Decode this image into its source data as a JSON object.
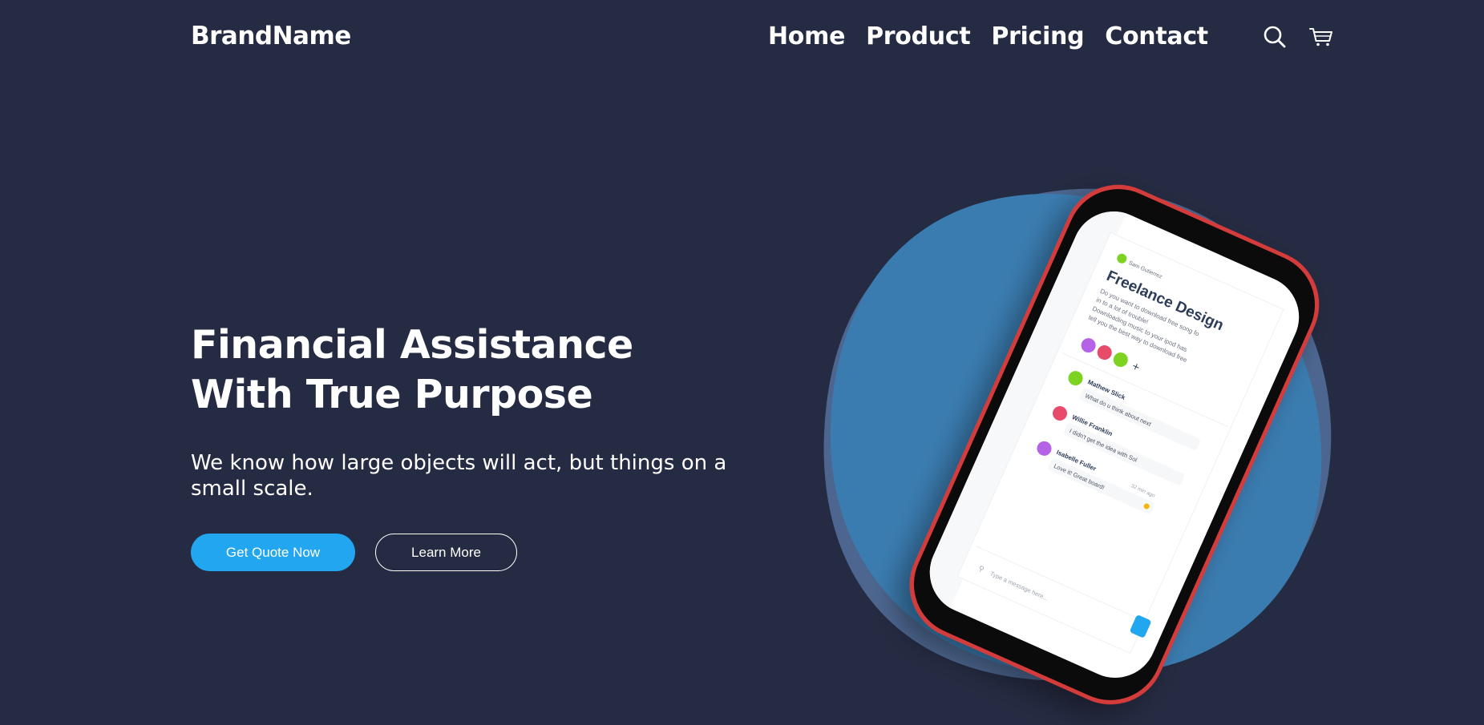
{
  "header": {
    "brand": "BrandName",
    "nav": [
      {
        "label": "Home"
      },
      {
        "label": "Product"
      },
      {
        "label": "Pricing"
      },
      {
        "label": "Contact"
      }
    ],
    "icons": [
      "search-icon",
      "cart-icon"
    ]
  },
  "hero": {
    "title_line1": "Financial Assistance",
    "title_line2": "With True Purpose",
    "subtitle": "We know how large objects will act, but things on a small scale.",
    "primary_button": "Get Quote Now",
    "secondary_button": "Learn More"
  },
  "phone_screen": {
    "author": "Sam Gutierrez",
    "card_title": "Freelance Design",
    "card_text": [
      "Do you want to download free song fo",
      "in to a lot of trouble!",
      "Downloading music to your ipod has",
      "tell you the best way to download free"
    ],
    "messages": [
      {
        "name": "Mathew Slick",
        "text": "What do u think about next"
      },
      {
        "name": "Willie Franklin",
        "text": "I didn't get the idea with Sol"
      },
      {
        "name": "Isabelle Fuller",
        "time": "32 min ago",
        "text": "Love it! Great board!"
      }
    ],
    "input_placeholder": "Type a message here..."
  },
  "colors": {
    "background": "#252B42",
    "primary": "#23A6F0",
    "blob_light": "#3B7CB0",
    "blob_dark": "#4C668F",
    "phone_frame": "#D43A3A"
  }
}
